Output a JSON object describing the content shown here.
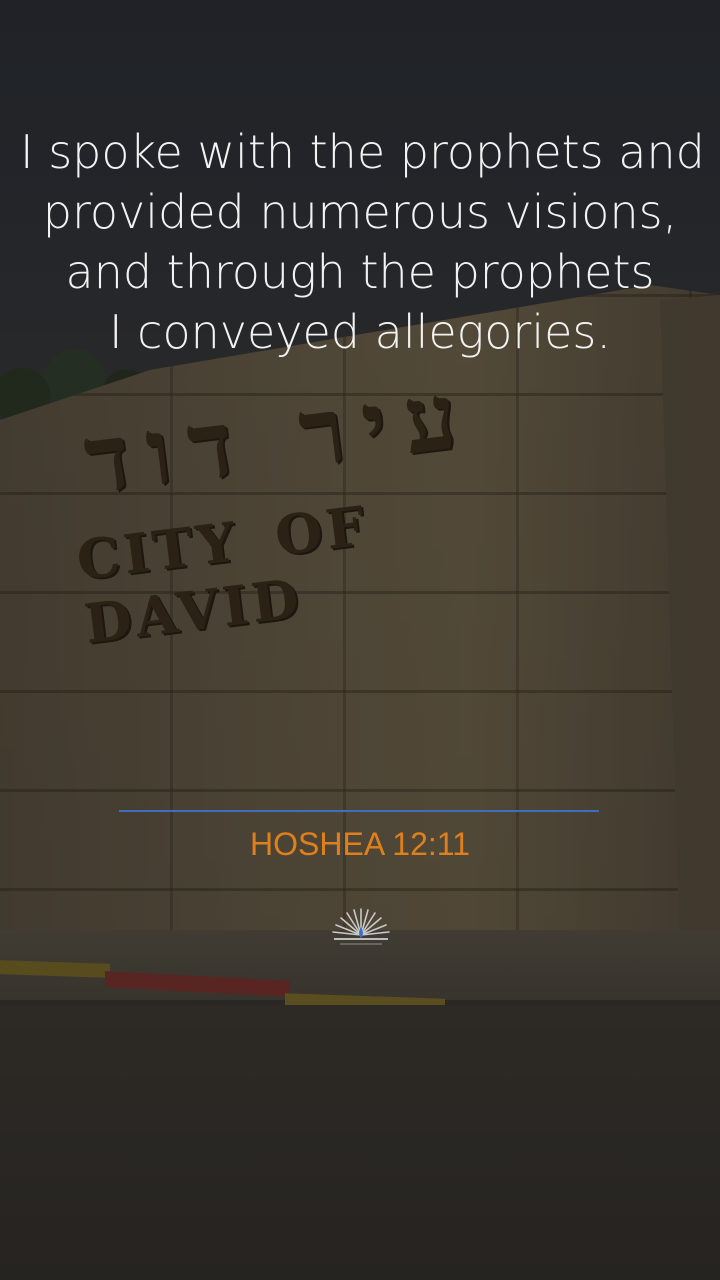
{
  "verse": {
    "lines": [
      "I spoke with the prophets and",
      "provided numerous visions,",
      "and through the prophets",
      "I conveyed allegories."
    ]
  },
  "reference": "HOSHEA 12:11",
  "background": {
    "inscription_hebrew": "עיר דוד",
    "inscription_english": "CITY OF DAVID"
  },
  "logo": {
    "icon": "menorah-sunburst-icon"
  },
  "colors": {
    "verse_text": "#f2f2f2",
    "reference_text": "#e0801d",
    "divider": "#3e6dc4"
  }
}
